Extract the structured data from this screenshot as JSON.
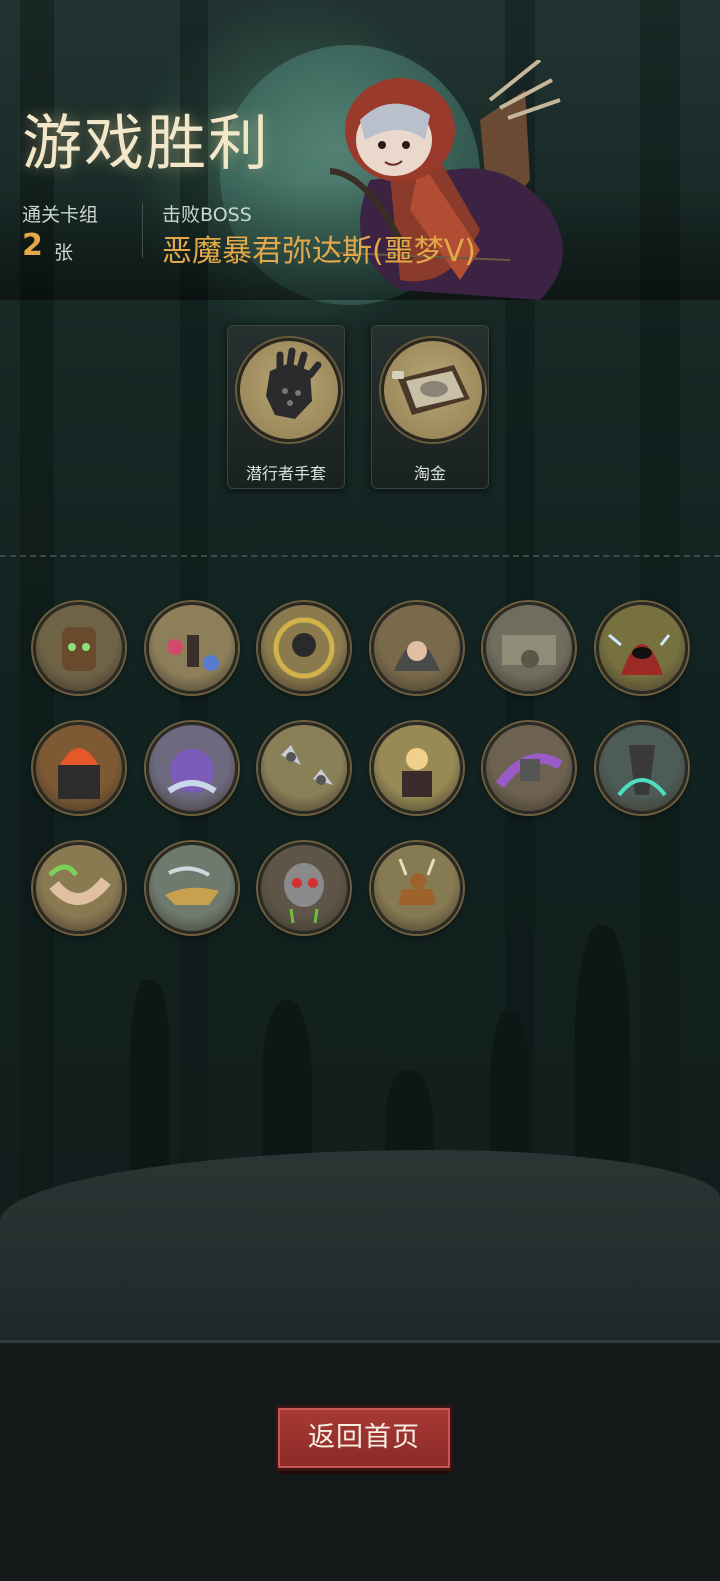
{
  "header": {
    "title": "游戏胜利",
    "deck_label": "通关卡组",
    "deck_count": "2",
    "deck_unit": "张",
    "boss_label": "击败BOSS",
    "boss_name": "恶魔暴君弥达斯(噩梦V)"
  },
  "relics": [
    {
      "name": "潜行者手套",
      "icon": "glove-icon"
    },
    {
      "name": "淘金",
      "icon": "gold-pan-icon"
    }
  ],
  "cards": [
    {
      "icon": "barrel-monster-icon",
      "bg": "#6f6346"
    },
    {
      "icon": "balloon-skeleton-icon",
      "bg": "#8c7f5a"
    },
    {
      "icon": "skull-medallion-icon",
      "bg": "#8b7a4e"
    },
    {
      "icon": "hooded-merchant-icon",
      "bg": "#7a6a4c"
    },
    {
      "icon": "old-machine-icon",
      "bg": "#6e6d5e"
    },
    {
      "icon": "red-hood-mage-icon",
      "bg": "#77703f"
    },
    {
      "icon": "fire-altar-icon",
      "bg": "#7d5a34"
    },
    {
      "icon": "tentacle-monster-icon",
      "bg": "#6d6a80"
    },
    {
      "icon": "shuriken-icon",
      "bg": "#8a8058"
    },
    {
      "icon": "blonde-girl-chair-icon",
      "bg": "#978a55"
    },
    {
      "icon": "purple-slash-icon",
      "bg": "#6d6150"
    },
    {
      "icon": "green-claw-icon",
      "bg": "#4d5c56"
    },
    {
      "icon": "green-fire-body-icon",
      "bg": "#8a7a52"
    },
    {
      "icon": "magic-lamp-icon",
      "bg": "#6f7a6e"
    },
    {
      "icon": "robot-skull-icon",
      "bg": "#5e5448"
    },
    {
      "icon": "deer-icon",
      "bg": "#867a52"
    }
  ],
  "button": {
    "label": "返回首页"
  }
}
